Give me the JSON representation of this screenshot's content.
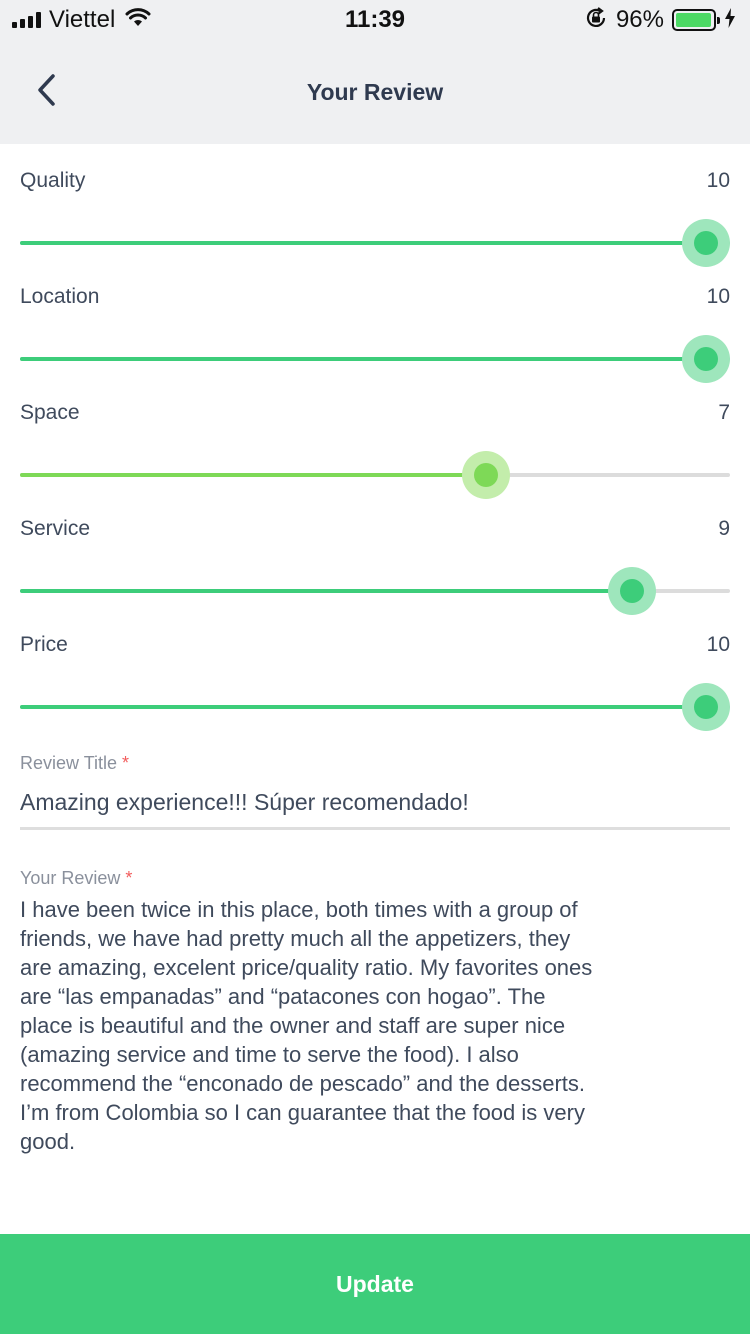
{
  "status_bar": {
    "carrier": "Viettel",
    "time": "11:39",
    "battery_percent": "96%",
    "battery_level": 0.96
  },
  "nav": {
    "title": "Your Review",
    "back_icon": "chevron-left-icon"
  },
  "ratings": [
    {
      "label": "Quality",
      "value": "10",
      "level": 1.0,
      "color": "#3dcd7a",
      "halo": "#9ee6bc"
    },
    {
      "label": "Location",
      "value": "10",
      "level": 1.0,
      "color": "#3dcd7a",
      "halo": "#9ee6bc"
    },
    {
      "label": "Space",
      "value": "7",
      "level": 0.656,
      "color": "#7ed957",
      "halo": "#c3edab"
    },
    {
      "label": "Service",
      "value": "9",
      "level": 0.862,
      "color": "#3dcd7a",
      "halo": "#9ee6bc"
    },
    {
      "label": "Price",
      "value": "10",
      "level": 1.0,
      "color": "#3dcd7a",
      "halo": "#9ee6bc"
    }
  ],
  "form": {
    "title_label": "Review Title",
    "title_value": "Amazing experience!!! Súper recomendado!",
    "review_label": "Your Review",
    "required_mark": "*",
    "review_value": "I have been twice in this place, both times with a group of\nfriends, we have had pretty much all the appetizers, they\nare amazing, excelent price/quality ratio. My favorites ones\nare “las empanadas” and “patacones con hogao”. The\nplace is beautiful and the owner and staff are super nice\n(amazing service and time to serve the food). I also\nrecommend the “enconado de pescado” and the desserts.\nI’m from Colombia so I can guarantee that the food is very\ngood."
  },
  "update_button": {
    "label": "Update"
  },
  "colors": {
    "accent": "#3dcd7a",
    "header_bg": "#eff0f2",
    "text": "#3f4a5c",
    "required": "#f25c5c"
  }
}
